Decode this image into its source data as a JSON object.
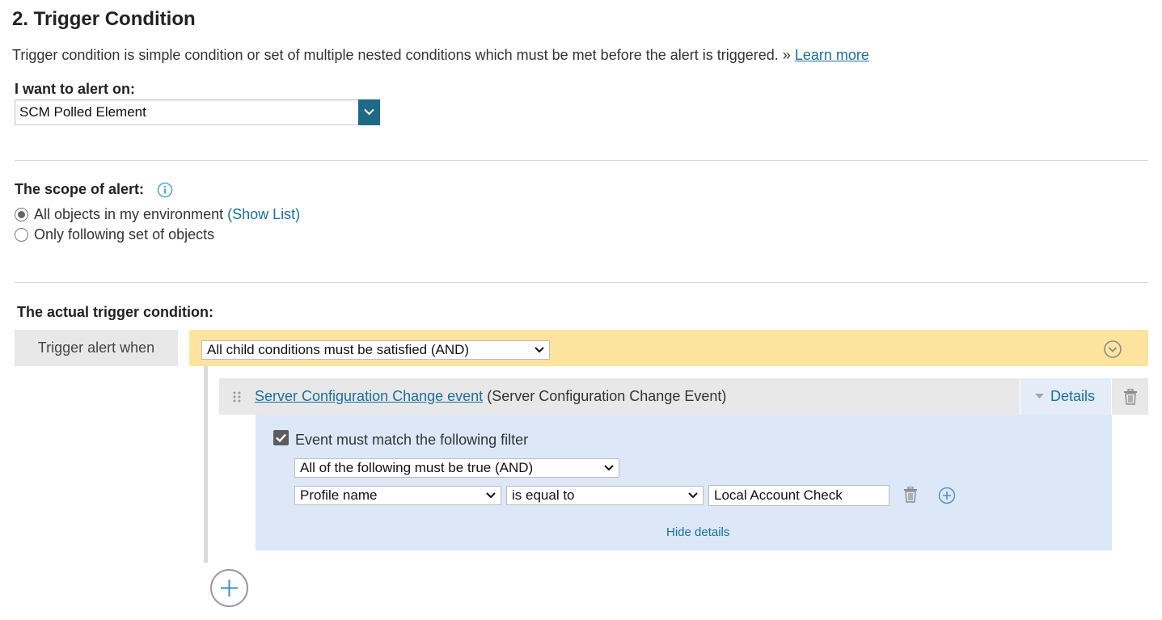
{
  "section": {
    "title": "2. Trigger Condition",
    "description": "Trigger condition is simple condition or set of multiple nested conditions which must be met before the alert is triggered. »",
    "learn_more": "Learn more"
  },
  "alert_on": {
    "label": "I want to alert on:",
    "value": "SCM Polled Element"
  },
  "scope": {
    "label": "The scope of alert:",
    "options": [
      {
        "label": "All objects in my environment",
        "link": "(Show List)",
        "selected": true
      },
      {
        "label": "Only following set of objects",
        "selected": false
      }
    ]
  },
  "trigger": {
    "label": "The actual trigger condition:",
    "when_label": "Trigger alert when",
    "logic": "All child conditions must be satisfied (AND)",
    "condition": {
      "link": "Server Configuration Change event",
      "type": "(Server Configuration Change Event)",
      "details_label": "Details"
    },
    "filter": {
      "checkbox_label": "Event must match the following filter",
      "checked": true,
      "logic": "All of the following must be true (AND)",
      "field": "Profile name",
      "operator": "is equal to",
      "value": "Local Account Check",
      "hide_details": "Hide details"
    }
  },
  "colors": {
    "accent": "#1a6fa0",
    "dropdown_button": "#1e6a86",
    "condition_bar": "#fde49e",
    "filter_panel": "#dce8f8"
  }
}
